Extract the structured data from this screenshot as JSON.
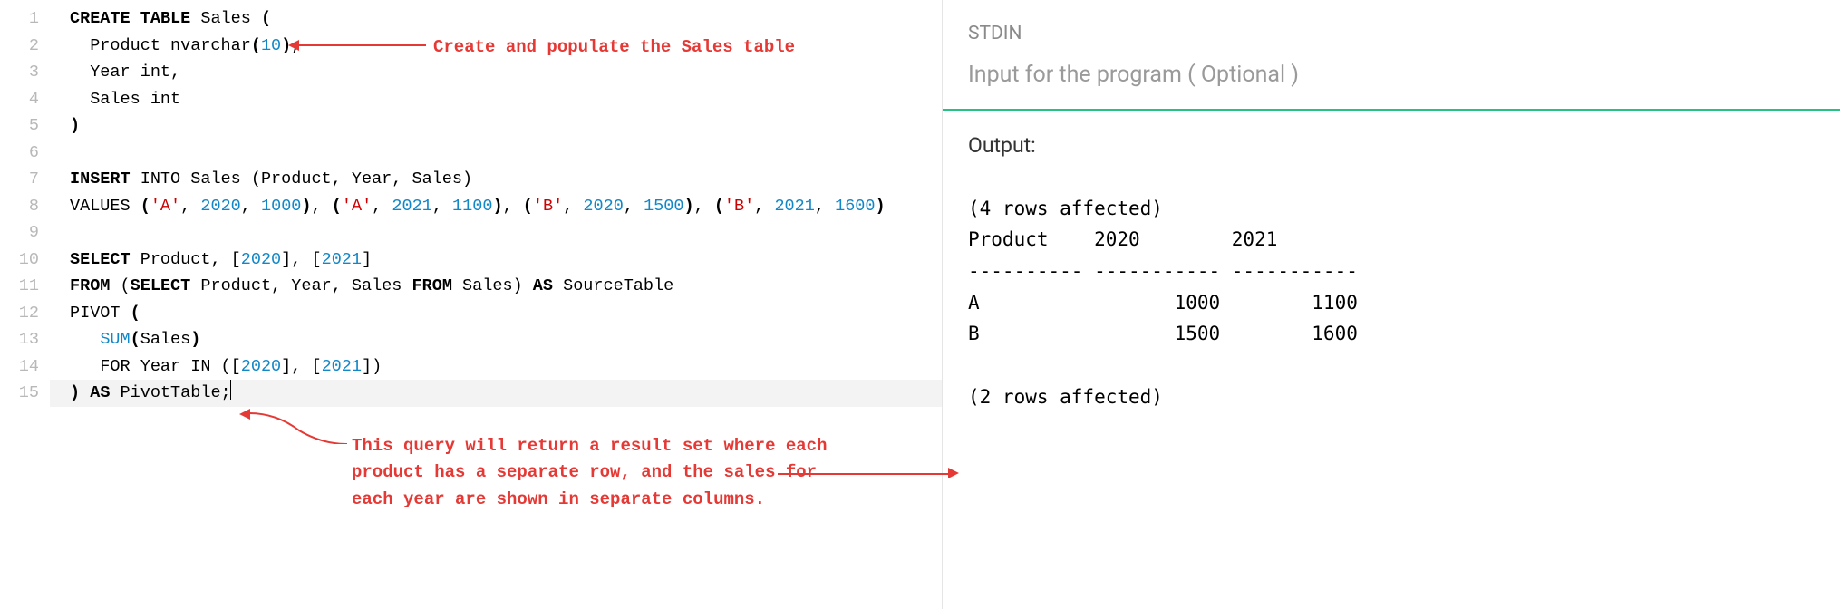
{
  "editor": {
    "line_count": 15,
    "current_line": 15,
    "code_lines": [
      {
        "html": "<span class=\"kw\">CREATE</span> <span class=\"kw\">TABLE</span> Sales <span class=\"kw\">(</span>"
      },
      {
        "html": "  Product nvarchar<span class=\"kw\">(</span><span class=\"num\">10</span><span class=\"kw\">)</span>,"
      },
      {
        "html": "  Year int,"
      },
      {
        "html": "  Sales int"
      },
      {
        "html": "<span class=\"kw\">)</span>"
      },
      {
        "html": ""
      },
      {
        "html": "<span class=\"kw\">INSERT</span> INTO Sales (Product, Year, Sales)"
      },
      {
        "html": "VALUES <span class=\"kw\">(</span><span class=\"str\">'A'</span>, <span class=\"num\">2020</span>, <span class=\"num\">1000</span><span class=\"kw\">)</span>, <span class=\"kw\">(</span><span class=\"str\">'A'</span>, <span class=\"num\">2021</span>, <span class=\"num\">1100</span><span class=\"kw\">)</span>, <span class=\"kw\">(</span><span class=\"str\">'B'</span>, <span class=\"num\">2020</span>, <span class=\"num\">1500</span><span class=\"kw\">)</span>, <span class=\"kw\">(</span><span class=\"str\">'B'</span>, <span class=\"num\">2021</span>, <span class=\"num\">1600</span><span class=\"kw\">)</span>"
      },
      {
        "html": ""
      },
      {
        "html": "<span class=\"kw\">SELECT</span> Product, [<span class=\"num\">2020</span>], [<span class=\"num\">2021</span>]"
      },
      {
        "html": "<span class=\"kw\">FROM</span> (<span class=\"kw\">SELECT</span> Product, Year, Sales <span class=\"kw\">FROM</span> Sales) <span class=\"kw\">AS</span> SourceTable"
      },
      {
        "html": "PIVOT <span class=\"kw\">(</span>"
      },
      {
        "html": "   <span class=\"fn\">SUM</span><span class=\"kw\">(</span>Sales<span class=\"kw\">)</span>"
      },
      {
        "html": "   FOR Year IN ([<span class=\"num\">2020</span>], [<span class=\"num\">2021</span>])"
      },
      {
        "html": "<span class=\"kw\">)</span> <span class=\"kw\">AS</span> PivotTable;<span class=\"cursor\"></span>"
      }
    ]
  },
  "annotations": {
    "a1": "Create and populate the Sales table",
    "a2_l1": "This query will return a result set where each",
    "a2_l2": "product has a separate row, and the sales for",
    "a2_l3": "each year are shown in separate columns."
  },
  "io": {
    "stdin_label": "STDIN",
    "stdin_placeholder": "Input for the program ( Optional )",
    "output_label": "Output:",
    "output_text": "(4 rows affected)\nProduct    2020        2021\n---------- ----------- -----------\nA                 1000        1100\nB                 1500        1600\n\n(2 rows affected)"
  }
}
